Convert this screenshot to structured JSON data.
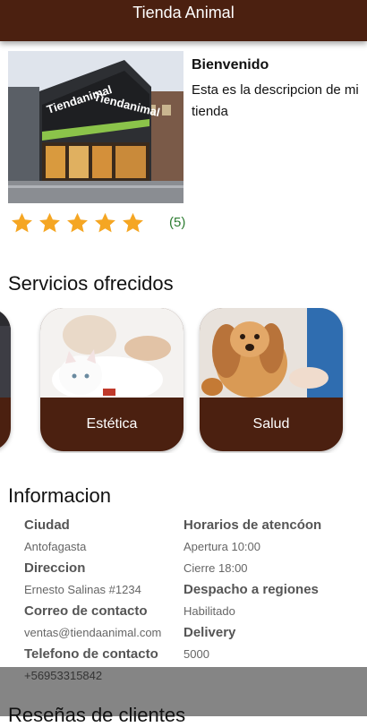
{
  "appbar": {
    "title": "Tienda Animal"
  },
  "store": {
    "sign_text": "Tiendanimal",
    "welcome_title": "Bienvenido",
    "description": "Esta es la descripcion de mi tienda",
    "rating": {
      "stars": 5,
      "max": 5,
      "count_label": "(5)"
    }
  },
  "services": {
    "title": "Servicios ofrecidos",
    "items": [
      {
        "label": ""
      },
      {
        "label": "Estética"
      },
      {
        "label": "Salud"
      }
    ]
  },
  "info": {
    "title": "Informacion",
    "left": [
      {
        "label": "Ciudad",
        "value": "Antofagasta"
      },
      {
        "label": "Direccion",
        "value": "Ernesto Salinas #1234"
      },
      {
        "label": "Correo de contacto",
        "value": "ventas@tiendaanimal.com"
      },
      {
        "label": "Telefono de contacto",
        "value": "+56953315842"
      }
    ],
    "right": [
      {
        "label": "Horarios de atencóon",
        "values": [
          "Apertura 10:00",
          "Cierre 18:00"
        ]
      },
      {
        "label": "Despacho a regiones",
        "values": [
          "Habilitado"
        ]
      },
      {
        "label": "Delivery",
        "values": [
          "5000"
        ]
      }
    ]
  },
  "reviews": {
    "title": "Reseñas de clientes"
  },
  "colors": {
    "brand": "#4b2010",
    "star": "#f5a623",
    "rating_count": "#2e7d32"
  },
  "icons": {
    "rating_star": "star-icon"
  }
}
